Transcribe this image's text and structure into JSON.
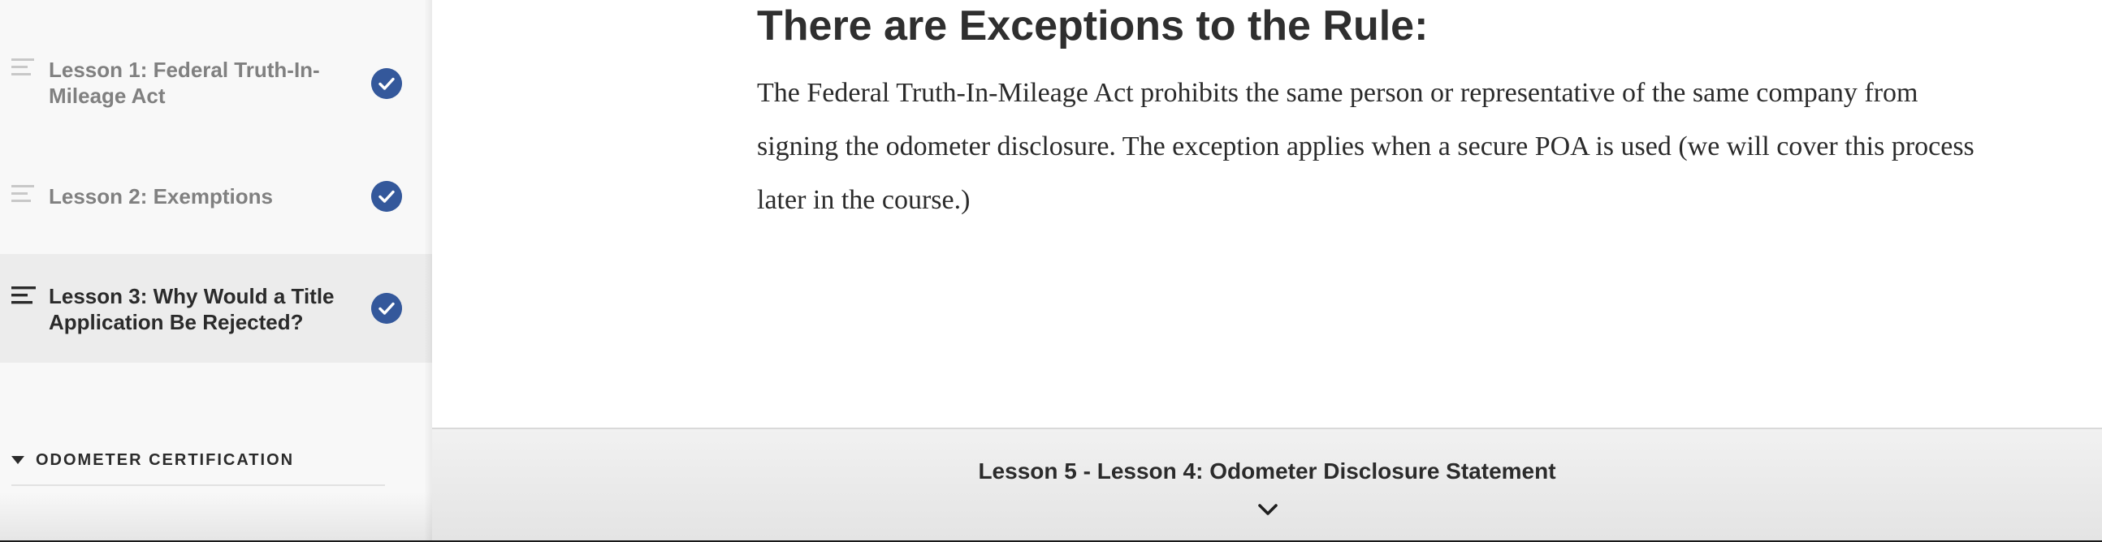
{
  "sidebar": {
    "lessons": [
      {
        "label": "Lesson 1: Federal Truth-In-Mileage Act",
        "completed": true,
        "active": false
      },
      {
        "label": "Lesson 2: Exemptions",
        "completed": true,
        "active": false
      },
      {
        "label": "Lesson 3: Why Would a Title Application Be Rejected?",
        "completed": true,
        "active": true
      }
    ],
    "section_label": "ODOMETER CERTIFICATION"
  },
  "main": {
    "heading": "There are Exceptions to the Rule:",
    "body": "The Federal Truth-In-Mileage Act prohibits the same person or representative of the same company from signing the odometer disclosure. The exception applies when a secure POA is used (we will cover this process later in the course.)"
  },
  "footer": {
    "next_lesson": "Lesson 5 - Lesson 4: Odometer Disclosure Statement"
  },
  "colors": {
    "check_badge": "#34589b",
    "sidebar_bg": "#f8f8f8",
    "active_row_bg": "#ececec"
  },
  "icons": {
    "lesson_row": "menu-lines-icon",
    "completed": "checkmark-circle-icon",
    "section_toggle": "caret-down-icon",
    "next": "chevron-down-icon"
  }
}
